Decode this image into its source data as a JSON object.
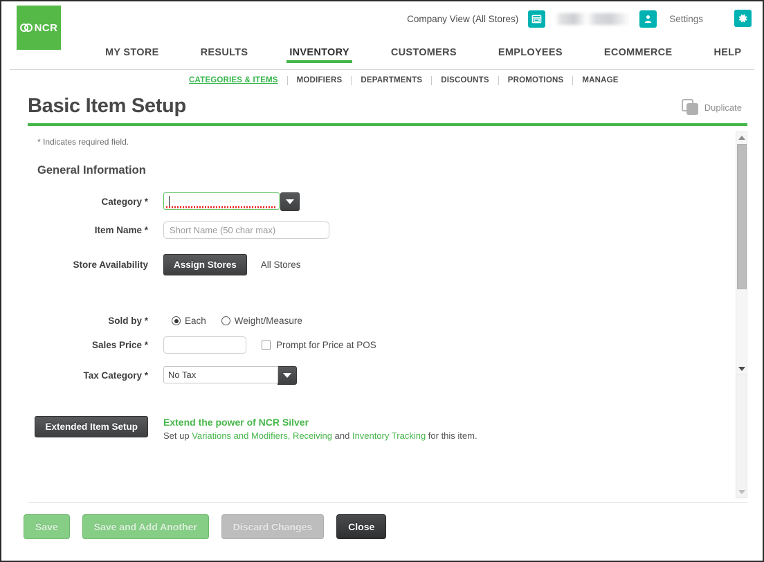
{
  "header": {
    "logo_text": "NCR",
    "company_view": "Company View (All Stores)",
    "store_icon": "store-icon",
    "user_icon": "user-icon",
    "settings_label": "Settings",
    "gear_icon": "gear-icon"
  },
  "main_nav": [
    {
      "label": "MY STORE",
      "active": false
    },
    {
      "label": "RESULTS",
      "active": false
    },
    {
      "label": "INVENTORY",
      "active": true
    },
    {
      "label": "CUSTOMERS",
      "active": false
    },
    {
      "label": "EMPLOYEES",
      "active": false
    },
    {
      "label": "ECOMMERCE",
      "active": false
    },
    {
      "label": "HELP",
      "active": false
    }
  ],
  "sub_nav": [
    {
      "label": "CATEGORIES & ITEMS",
      "active": true
    },
    {
      "label": "MODIFIERS",
      "active": false
    },
    {
      "label": "DEPARTMENTS",
      "active": false
    },
    {
      "label": "DISCOUNTS",
      "active": false
    },
    {
      "label": "PROMOTIONS",
      "active": false
    },
    {
      "label": "MANAGE",
      "active": false
    }
  ],
  "page": {
    "title": "Basic Item Setup",
    "duplicate_label": "Duplicate",
    "duplicate_icon": "copy-icon",
    "required_note": "* Indicates required field.",
    "section_title": "General Information"
  },
  "form": {
    "category": {
      "label": "Category *",
      "value": "",
      "focused": true,
      "spellcheck_underline": true
    },
    "item_name": {
      "label": "Item Name *",
      "value": "",
      "placeholder": "Short Name (50 char max)"
    },
    "store_availability": {
      "label": "Store Availability",
      "assign_button": "Assign Stores",
      "all_stores": "All Stores"
    },
    "sold_by": {
      "label": "Sold by *",
      "options": [
        {
          "label": "Each",
          "selected": true
        },
        {
          "label": "Weight/Measure",
          "selected": false
        }
      ]
    },
    "sales_price": {
      "label": "Sales Price *",
      "value": "",
      "prompt_checkbox_label": "Prompt for Price at POS",
      "prompt_checked": false
    },
    "tax_category": {
      "label": "Tax Category *",
      "value": "No Tax"
    }
  },
  "promo": {
    "button_label": "Extended Item Setup",
    "heading": "Extend the power of NCR Silver",
    "line_prefix": "Set up ",
    "link1": "Variations and Modifiers,",
    "mid1": " ",
    "link2": "Receiving",
    "mid2": " and ",
    "link3": "Inventory Tracking",
    "suffix": " for this item."
  },
  "footer": {
    "save": "Save",
    "save_add_another": "Save and Add Another",
    "discard": "Discard Changes",
    "close": "Close"
  },
  "colors": {
    "brand_green": "#55b947",
    "accent_green": "#45b649",
    "teal": "#00b2b2",
    "dark_button": "#3f4042"
  }
}
